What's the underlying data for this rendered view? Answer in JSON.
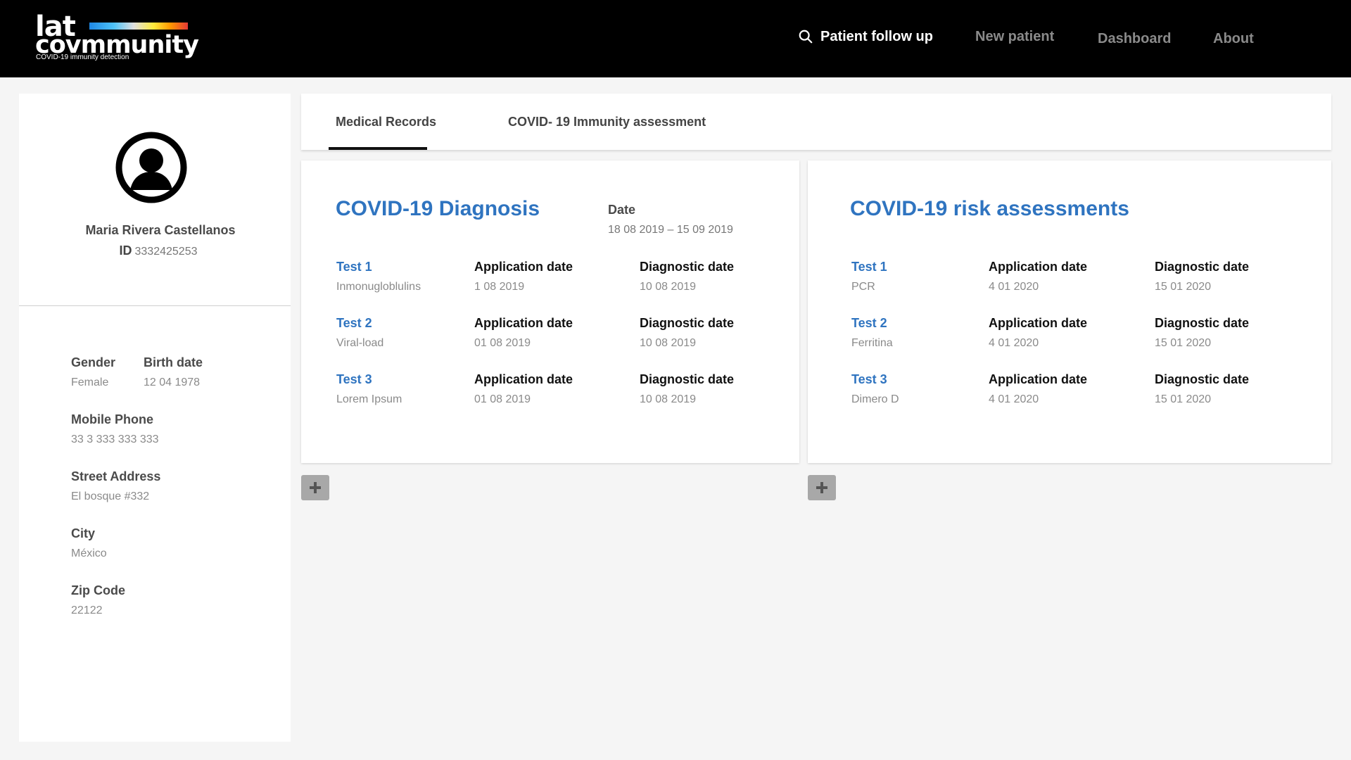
{
  "brand": {
    "line1": "lat",
    "line2": "covmmunity",
    "tagline": "COVID-19 immunity detection"
  },
  "nav": {
    "items": [
      {
        "label": "Patient follow up",
        "icon": "search-icon",
        "active": true
      },
      {
        "label": "New patient",
        "active": false
      },
      {
        "label": "Dashboard",
        "active": false
      },
      {
        "label": "About",
        "active": false
      }
    ]
  },
  "patient": {
    "avatar_icon": "user-avatar-icon",
    "name": "Maria Rivera Castellanos",
    "id_label": "ID",
    "id_value": "3332425253",
    "fields": {
      "gender": {
        "label": "Gender",
        "value": "Female"
      },
      "birth_date": {
        "label": "Birth date",
        "value": "12 04 1978"
      },
      "mobile": {
        "label": "Mobile Phone",
        "value": "33 3 333 333 333"
      },
      "address": {
        "label": "Street Address",
        "value": "El bosque #332"
      },
      "city": {
        "label": "City",
        "value": "México"
      },
      "zip": {
        "label": "Zip Code",
        "value": "22122"
      }
    }
  },
  "tabs": [
    {
      "label": "Medical Records",
      "active": true
    },
    {
      "label": "COVID- 19 Immunity assessment",
      "active": false
    }
  ],
  "diagnosis": {
    "title": "COVID-19 Diagnosis",
    "date_label": "Date",
    "date_range": "18 08 2019  –  15 09 2019",
    "rows": [
      {
        "test": "Test 1",
        "type": "Inmonugloblulins",
        "app_label": "Application date",
        "app_date": "1 08 2019",
        "diag_label": "Diagnostic date",
        "diag_date": "10 08 2019"
      },
      {
        "test": "Test 2",
        "type": "Viral-load",
        "app_label": "Application date",
        "app_date": "01 08 2019",
        "diag_label": "Diagnostic date",
        "diag_date": "10 08 2019"
      },
      {
        "test": "Test 3",
        "type": "Lorem Ipsum",
        "app_label": "Application date",
        "app_date": "01 08 2019",
        "diag_label": "Diagnostic date",
        "diag_date": "10 08 2019"
      }
    ]
  },
  "risk": {
    "title": "COVID-19 risk assessments",
    "rows": [
      {
        "test": "Test 1",
        "type": "PCR",
        "app_label": "Application date",
        "app_date": "4 01 2020",
        "diag_label": "Diagnostic date",
        "diag_date": "15 01 2020"
      },
      {
        "test": "Test 2",
        "type": "Ferritina",
        "app_label": "Application date",
        "app_date": "4 01 2020",
        "diag_label": "Diagnostic date",
        "diag_date": "15 01 2020"
      },
      {
        "test": "Test 3",
        "type": "Dimero D",
        "app_label": "Application date",
        "app_date": "4 01 2020",
        "diag_label": "Diagnostic date",
        "diag_date": "15 01 2020"
      }
    ]
  },
  "colors": {
    "accent_blue": "#2f74c0",
    "header_bg": "#000000",
    "add_button_bg": "#a8a8a8"
  }
}
